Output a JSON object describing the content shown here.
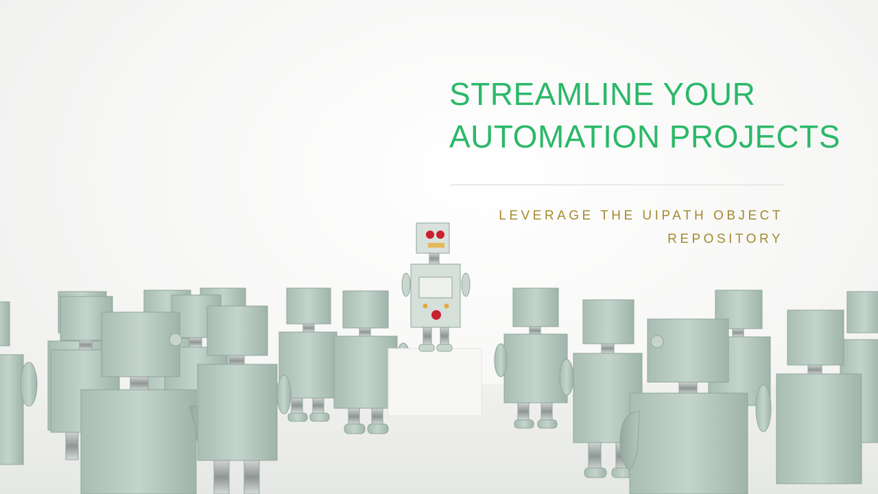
{
  "slide": {
    "headline_line1": "STREAMLINE YOUR",
    "headline_line2": "AUTOMATION PROJECTS",
    "subheadline_line1": "LEVERAGE THE UIPATH OBJECT",
    "subheadline_line2": "REPOSITORY"
  },
  "colors": {
    "headline": "#2bb868",
    "subheadline": "#a5892e",
    "robot_body": "#b8cbc2",
    "robot_eyes": "#c8212f"
  },
  "image": {
    "subject": "robots-crowd-illustration"
  }
}
